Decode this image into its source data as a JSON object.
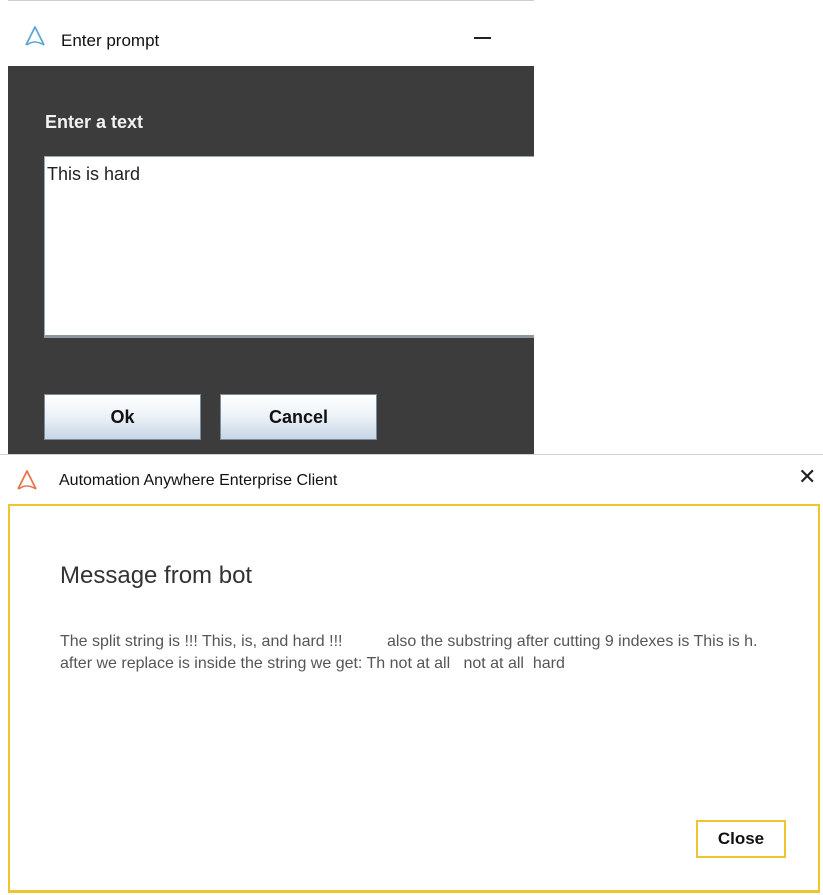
{
  "colors": {
    "accent": "#f0c330",
    "dialog_bg": "#3c3c3c",
    "app_icon": "#5aa7d6"
  },
  "prompt_window": {
    "title": "Enter prompt",
    "label": "Enter a text",
    "input_value": "This is hard",
    "ok_label": "Ok",
    "cancel_label": "Cancel",
    "icons": {
      "app": "automation-anywhere-logo-icon",
      "minimize": "minimize-icon"
    }
  },
  "message_window": {
    "title": "Automation Anywhere Enterprise Client",
    "heading": "Message from bot",
    "message": "The split string is !!! This, is, and hard !!!          also the substring after cutting 9 indexes is This is h.                after we replace is inside the string we get: Th not at all   not at all  hard",
    "close_label": "Close",
    "close_glyph": "✕",
    "icons": {
      "app": "automation-anywhere-logo-icon",
      "close": "close-icon"
    }
  }
}
